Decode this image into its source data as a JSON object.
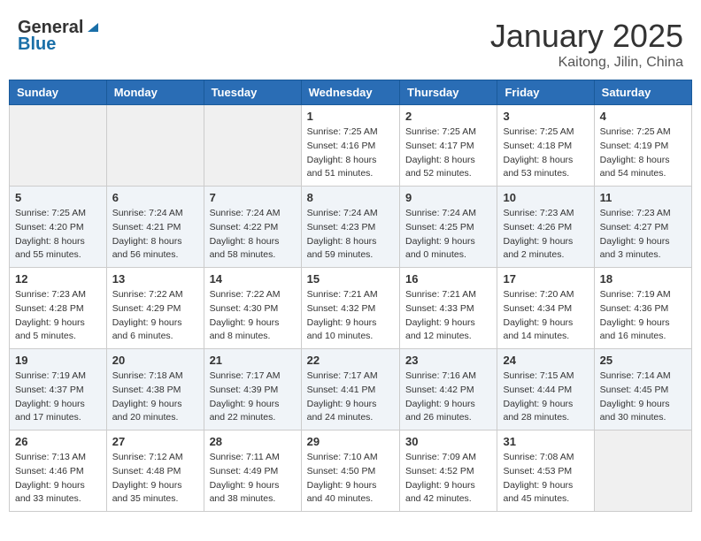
{
  "header": {
    "logo_general": "General",
    "logo_blue": "Blue",
    "month_title": "January 2025",
    "location": "Kaitong, Jilin, China"
  },
  "weekdays": [
    "Sunday",
    "Monday",
    "Tuesday",
    "Wednesday",
    "Thursday",
    "Friday",
    "Saturday"
  ],
  "weeks": [
    [
      {
        "day": "",
        "empty": true
      },
      {
        "day": "",
        "empty": true
      },
      {
        "day": "",
        "empty": true
      },
      {
        "day": "1",
        "sunrise": "7:25 AM",
        "sunset": "4:16 PM",
        "daylight": "8 hours and 51 minutes."
      },
      {
        "day": "2",
        "sunrise": "7:25 AM",
        "sunset": "4:17 PM",
        "daylight": "8 hours and 52 minutes."
      },
      {
        "day": "3",
        "sunrise": "7:25 AM",
        "sunset": "4:18 PM",
        "daylight": "8 hours and 53 minutes."
      },
      {
        "day": "4",
        "sunrise": "7:25 AM",
        "sunset": "4:19 PM",
        "daylight": "8 hours and 54 minutes."
      }
    ],
    [
      {
        "day": "5",
        "sunrise": "7:25 AM",
        "sunset": "4:20 PM",
        "daylight": "8 hours and 55 minutes."
      },
      {
        "day": "6",
        "sunrise": "7:24 AM",
        "sunset": "4:21 PM",
        "daylight": "8 hours and 56 minutes."
      },
      {
        "day": "7",
        "sunrise": "7:24 AM",
        "sunset": "4:22 PM",
        "daylight": "8 hours and 58 minutes."
      },
      {
        "day": "8",
        "sunrise": "7:24 AM",
        "sunset": "4:23 PM",
        "daylight": "8 hours and 59 minutes."
      },
      {
        "day": "9",
        "sunrise": "7:24 AM",
        "sunset": "4:25 PM",
        "daylight": "9 hours and 0 minutes."
      },
      {
        "day": "10",
        "sunrise": "7:23 AM",
        "sunset": "4:26 PM",
        "daylight": "9 hours and 2 minutes."
      },
      {
        "day": "11",
        "sunrise": "7:23 AM",
        "sunset": "4:27 PM",
        "daylight": "9 hours and 3 minutes."
      }
    ],
    [
      {
        "day": "12",
        "sunrise": "7:23 AM",
        "sunset": "4:28 PM",
        "daylight": "9 hours and 5 minutes."
      },
      {
        "day": "13",
        "sunrise": "7:22 AM",
        "sunset": "4:29 PM",
        "daylight": "9 hours and 6 minutes."
      },
      {
        "day": "14",
        "sunrise": "7:22 AM",
        "sunset": "4:30 PM",
        "daylight": "9 hours and 8 minutes."
      },
      {
        "day": "15",
        "sunrise": "7:21 AM",
        "sunset": "4:32 PM",
        "daylight": "9 hours and 10 minutes."
      },
      {
        "day": "16",
        "sunrise": "7:21 AM",
        "sunset": "4:33 PM",
        "daylight": "9 hours and 12 minutes."
      },
      {
        "day": "17",
        "sunrise": "7:20 AM",
        "sunset": "4:34 PM",
        "daylight": "9 hours and 14 minutes."
      },
      {
        "day": "18",
        "sunrise": "7:19 AM",
        "sunset": "4:36 PM",
        "daylight": "9 hours and 16 minutes."
      }
    ],
    [
      {
        "day": "19",
        "sunrise": "7:19 AM",
        "sunset": "4:37 PM",
        "daylight": "9 hours and 17 minutes."
      },
      {
        "day": "20",
        "sunrise": "7:18 AM",
        "sunset": "4:38 PM",
        "daylight": "9 hours and 20 minutes."
      },
      {
        "day": "21",
        "sunrise": "7:17 AM",
        "sunset": "4:39 PM",
        "daylight": "9 hours and 22 minutes."
      },
      {
        "day": "22",
        "sunrise": "7:17 AM",
        "sunset": "4:41 PM",
        "daylight": "9 hours and 24 minutes."
      },
      {
        "day": "23",
        "sunrise": "7:16 AM",
        "sunset": "4:42 PM",
        "daylight": "9 hours and 26 minutes."
      },
      {
        "day": "24",
        "sunrise": "7:15 AM",
        "sunset": "4:44 PM",
        "daylight": "9 hours and 28 minutes."
      },
      {
        "day": "25",
        "sunrise": "7:14 AM",
        "sunset": "4:45 PM",
        "daylight": "9 hours and 30 minutes."
      }
    ],
    [
      {
        "day": "26",
        "sunrise": "7:13 AM",
        "sunset": "4:46 PM",
        "daylight": "9 hours and 33 minutes."
      },
      {
        "day": "27",
        "sunrise": "7:12 AM",
        "sunset": "4:48 PM",
        "daylight": "9 hours and 35 minutes."
      },
      {
        "day": "28",
        "sunrise": "7:11 AM",
        "sunset": "4:49 PM",
        "daylight": "9 hours and 38 minutes."
      },
      {
        "day": "29",
        "sunrise": "7:10 AM",
        "sunset": "4:50 PM",
        "daylight": "9 hours and 40 minutes."
      },
      {
        "day": "30",
        "sunrise": "7:09 AM",
        "sunset": "4:52 PM",
        "daylight": "9 hours and 42 minutes."
      },
      {
        "day": "31",
        "sunrise": "7:08 AM",
        "sunset": "4:53 PM",
        "daylight": "9 hours and 45 minutes."
      },
      {
        "day": "",
        "empty": true
      }
    ]
  ]
}
